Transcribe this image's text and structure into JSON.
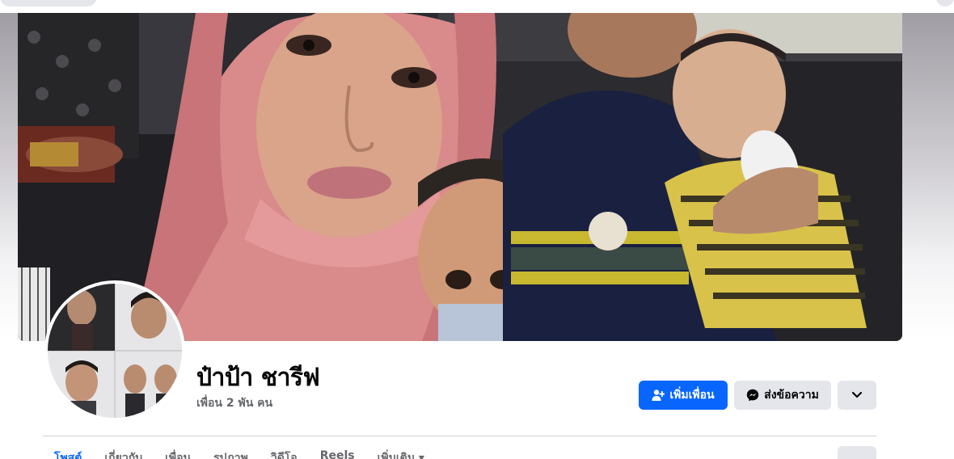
{
  "profile": {
    "name": "ป๋าป้า ชารีฟ",
    "friend_count": "เพื่อน 2 พัน คน"
  },
  "actions": {
    "add_friend": "เพิ่มเพื่อน",
    "message": "ส่งข้อความ"
  },
  "tabs": [
    {
      "label": "โพสต์"
    },
    {
      "label": "เกี่ยวกับ"
    },
    {
      "label": "เพื่อน"
    },
    {
      "label": "รูปภาพ"
    },
    {
      "label": "วิดีโอ"
    },
    {
      "label": "Reels"
    },
    {
      "label": "เพิ่มเติม ▾"
    }
  ],
  "colors": {
    "primary": "#0866ff",
    "secondary_button": "#e4e6eb",
    "text_primary": "#050505",
    "text_secondary": "#65676b"
  },
  "icons": {
    "add_friend": "person-add-icon",
    "message": "messenger-icon",
    "more": "chevron-down-icon"
  }
}
